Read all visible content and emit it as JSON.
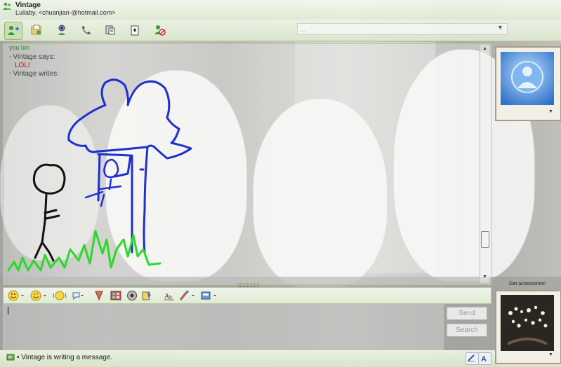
{
  "window": {
    "contact_name": "Vintage",
    "contact_subtitle": "Lullaby. <chuanjian-@hotmail.com>"
  },
  "toolbar": {
    "buttons": [
      {
        "icon": "invite-contact-icon"
      },
      {
        "icon": "send-files-icon"
      },
      {
        "icon": "video-call-icon"
      },
      {
        "icon": "voice-call-icon"
      },
      {
        "icon": "activities-icon"
      },
      {
        "icon": "games-icon"
      },
      {
        "icon": "block-contact-icon"
      }
    ]
  },
  "conversation": {
    "partial_top_line": "you lon",
    "messages": [
      {
        "sender_line": "Vintage says:",
        "text": "LOLI"
      },
      {
        "sender_line": "Vintage writes:",
        "text": ""
      }
    ],
    "ink_colors": {
      "blue": "#1d2fd0",
      "black": "#111111",
      "green": "#2bd82b"
    }
  },
  "format_toolbar": {
    "items": [
      "emoticon-icon",
      "wink-icon",
      "nudge-icon",
      "voice-clip-icon",
      "background-icon",
      "photo-icon",
      "gift-icon",
      "ink-icon",
      "font-icon",
      "brush-icon",
      "handwriting-icon"
    ]
  },
  "input": {
    "send_label": "Send",
    "search_label": "Search"
  },
  "status": {
    "text": "Vintage is writing a message."
  },
  "side": {
    "get_accessories": "Get accessories!"
  },
  "colors": {
    "accent": "#b6d39a",
    "frame": "#a99c82"
  }
}
